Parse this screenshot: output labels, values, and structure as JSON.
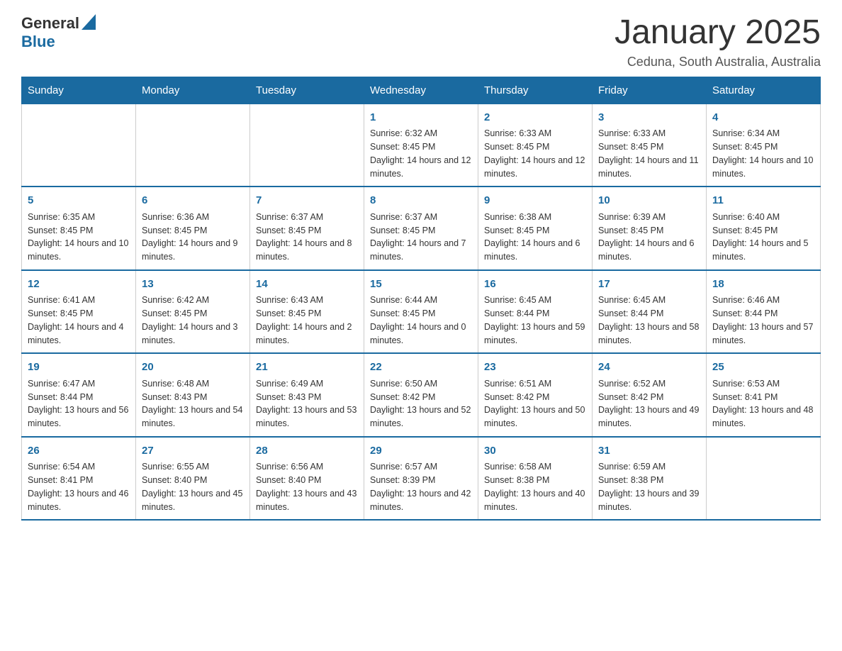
{
  "header": {
    "logo": {
      "general": "General",
      "blue": "Blue"
    },
    "title": "January 2025",
    "location": "Ceduna, South Australia, Australia"
  },
  "weekdays": [
    "Sunday",
    "Monday",
    "Tuesday",
    "Wednesday",
    "Thursday",
    "Friday",
    "Saturday"
  ],
  "weeks": [
    [
      {
        "day": "",
        "sunrise": "",
        "sunset": "",
        "daylight": ""
      },
      {
        "day": "",
        "sunrise": "",
        "sunset": "",
        "daylight": ""
      },
      {
        "day": "",
        "sunrise": "",
        "sunset": "",
        "daylight": ""
      },
      {
        "day": "1",
        "sunrise": "Sunrise: 6:32 AM",
        "sunset": "Sunset: 8:45 PM",
        "daylight": "Daylight: 14 hours and 12 minutes."
      },
      {
        "day": "2",
        "sunrise": "Sunrise: 6:33 AM",
        "sunset": "Sunset: 8:45 PM",
        "daylight": "Daylight: 14 hours and 12 minutes."
      },
      {
        "day": "3",
        "sunrise": "Sunrise: 6:33 AM",
        "sunset": "Sunset: 8:45 PM",
        "daylight": "Daylight: 14 hours and 11 minutes."
      },
      {
        "day": "4",
        "sunrise": "Sunrise: 6:34 AM",
        "sunset": "Sunset: 8:45 PM",
        "daylight": "Daylight: 14 hours and 10 minutes."
      }
    ],
    [
      {
        "day": "5",
        "sunrise": "Sunrise: 6:35 AM",
        "sunset": "Sunset: 8:45 PM",
        "daylight": "Daylight: 14 hours and 10 minutes."
      },
      {
        "day": "6",
        "sunrise": "Sunrise: 6:36 AM",
        "sunset": "Sunset: 8:45 PM",
        "daylight": "Daylight: 14 hours and 9 minutes."
      },
      {
        "day": "7",
        "sunrise": "Sunrise: 6:37 AM",
        "sunset": "Sunset: 8:45 PM",
        "daylight": "Daylight: 14 hours and 8 minutes."
      },
      {
        "day": "8",
        "sunrise": "Sunrise: 6:37 AM",
        "sunset": "Sunset: 8:45 PM",
        "daylight": "Daylight: 14 hours and 7 minutes."
      },
      {
        "day": "9",
        "sunrise": "Sunrise: 6:38 AM",
        "sunset": "Sunset: 8:45 PM",
        "daylight": "Daylight: 14 hours and 6 minutes."
      },
      {
        "day": "10",
        "sunrise": "Sunrise: 6:39 AM",
        "sunset": "Sunset: 8:45 PM",
        "daylight": "Daylight: 14 hours and 6 minutes."
      },
      {
        "day": "11",
        "sunrise": "Sunrise: 6:40 AM",
        "sunset": "Sunset: 8:45 PM",
        "daylight": "Daylight: 14 hours and 5 minutes."
      }
    ],
    [
      {
        "day": "12",
        "sunrise": "Sunrise: 6:41 AM",
        "sunset": "Sunset: 8:45 PM",
        "daylight": "Daylight: 14 hours and 4 minutes."
      },
      {
        "day": "13",
        "sunrise": "Sunrise: 6:42 AM",
        "sunset": "Sunset: 8:45 PM",
        "daylight": "Daylight: 14 hours and 3 minutes."
      },
      {
        "day": "14",
        "sunrise": "Sunrise: 6:43 AM",
        "sunset": "Sunset: 8:45 PM",
        "daylight": "Daylight: 14 hours and 2 minutes."
      },
      {
        "day": "15",
        "sunrise": "Sunrise: 6:44 AM",
        "sunset": "Sunset: 8:45 PM",
        "daylight": "Daylight: 14 hours and 0 minutes."
      },
      {
        "day": "16",
        "sunrise": "Sunrise: 6:45 AM",
        "sunset": "Sunset: 8:44 PM",
        "daylight": "Daylight: 13 hours and 59 minutes."
      },
      {
        "day": "17",
        "sunrise": "Sunrise: 6:45 AM",
        "sunset": "Sunset: 8:44 PM",
        "daylight": "Daylight: 13 hours and 58 minutes."
      },
      {
        "day": "18",
        "sunrise": "Sunrise: 6:46 AM",
        "sunset": "Sunset: 8:44 PM",
        "daylight": "Daylight: 13 hours and 57 minutes."
      }
    ],
    [
      {
        "day": "19",
        "sunrise": "Sunrise: 6:47 AM",
        "sunset": "Sunset: 8:44 PM",
        "daylight": "Daylight: 13 hours and 56 minutes."
      },
      {
        "day": "20",
        "sunrise": "Sunrise: 6:48 AM",
        "sunset": "Sunset: 8:43 PM",
        "daylight": "Daylight: 13 hours and 54 minutes."
      },
      {
        "day": "21",
        "sunrise": "Sunrise: 6:49 AM",
        "sunset": "Sunset: 8:43 PM",
        "daylight": "Daylight: 13 hours and 53 minutes."
      },
      {
        "day": "22",
        "sunrise": "Sunrise: 6:50 AM",
        "sunset": "Sunset: 8:42 PM",
        "daylight": "Daylight: 13 hours and 52 minutes."
      },
      {
        "day": "23",
        "sunrise": "Sunrise: 6:51 AM",
        "sunset": "Sunset: 8:42 PM",
        "daylight": "Daylight: 13 hours and 50 minutes."
      },
      {
        "day": "24",
        "sunrise": "Sunrise: 6:52 AM",
        "sunset": "Sunset: 8:42 PM",
        "daylight": "Daylight: 13 hours and 49 minutes."
      },
      {
        "day": "25",
        "sunrise": "Sunrise: 6:53 AM",
        "sunset": "Sunset: 8:41 PM",
        "daylight": "Daylight: 13 hours and 48 minutes."
      }
    ],
    [
      {
        "day": "26",
        "sunrise": "Sunrise: 6:54 AM",
        "sunset": "Sunset: 8:41 PM",
        "daylight": "Daylight: 13 hours and 46 minutes."
      },
      {
        "day": "27",
        "sunrise": "Sunrise: 6:55 AM",
        "sunset": "Sunset: 8:40 PM",
        "daylight": "Daylight: 13 hours and 45 minutes."
      },
      {
        "day": "28",
        "sunrise": "Sunrise: 6:56 AM",
        "sunset": "Sunset: 8:40 PM",
        "daylight": "Daylight: 13 hours and 43 minutes."
      },
      {
        "day": "29",
        "sunrise": "Sunrise: 6:57 AM",
        "sunset": "Sunset: 8:39 PM",
        "daylight": "Daylight: 13 hours and 42 minutes."
      },
      {
        "day": "30",
        "sunrise": "Sunrise: 6:58 AM",
        "sunset": "Sunset: 8:38 PM",
        "daylight": "Daylight: 13 hours and 40 minutes."
      },
      {
        "day": "31",
        "sunrise": "Sunrise: 6:59 AM",
        "sunset": "Sunset: 8:38 PM",
        "daylight": "Daylight: 13 hours and 39 minutes."
      },
      {
        "day": "",
        "sunrise": "",
        "sunset": "",
        "daylight": ""
      }
    ]
  ]
}
